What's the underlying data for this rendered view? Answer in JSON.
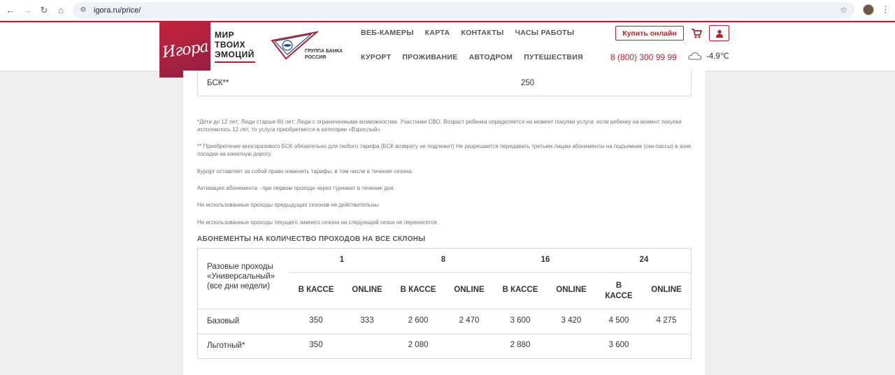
{
  "browser": {
    "url": "igora.ru/price/"
  },
  "header": {
    "logo_text": "Игора",
    "slogan": [
      "МИР",
      "ТВОИХ",
      "ЭМОЦИЙ"
    ],
    "bank_text": [
      "ГРУППА БАНКА",
      "РОССИЯ"
    ],
    "nav_top": [
      "ВЕБ-КАМЕРЫ",
      "КАРТА",
      "КОНТАКТЫ",
      "ЧАСЫ РАБОТЫ"
    ],
    "nav_bottom": [
      "КУРОРТ",
      "ПРОЖИВАНИЕ",
      "АВТОДРОМ",
      "ПУТЕШЕСТВИЯ"
    ],
    "buy_label": "Купить онлайн",
    "phone": "8 (800) 300 99 99",
    "temperature": "-4.9℃",
    "accent_color": "#b3232f"
  },
  "bsk": {
    "label": "БСК**",
    "value": "250"
  },
  "notes": [
    "*Дети до 12 лет; Люди старше 60 лет; Люди с ограниченными возможностми. Участники СВО. Возраст ребенка определяется на момент покупки услуги: если ребенку на момент покупки исполнилось 12 лет, то услуга приобретается в категории «Взрослый».",
    "** Приобретение многоразового БСК обязательно для любого тарифа (БСК возврату не подлежит) Не разрешается передавать третьим лицам абонементы на подъемник (ски-пассы) в зоне посадки на канатную дорогу.",
    "Курорт оставляет за собой право изменять тарифы, в том числе в течение сезона.",
    "Активация абонемента - при первом проходе через турникет в течение дня.",
    "Не использованные проходы предыдущих сезонов не действительны.",
    "Не использованные проходы текущего зимнего сезона на следующий сезон не переносятся."
  ],
  "passes": {
    "title": "АБОНЕМЕНТЫ НА КОЛИЧЕСТВО ПРОХОДОВ НА ВСЕ СКЛОНЫ",
    "corner_label": [
      "Разовые проходы",
      "«Универсальный»",
      "(все дни недели)"
    ],
    "groups": [
      "1",
      "8",
      "16",
      "24"
    ],
    "sub_headers": [
      "В КАССЕ",
      "ONLINE",
      "В КАССЕ",
      "ONLINE",
      "В КАССЕ",
      "ONLINE",
      "В КАССЕ",
      "ONLINE"
    ],
    "rows": [
      {
        "label": "Базовый",
        "cells": [
          "350",
          "333",
          "2 600",
          "2 470",
          "3 600",
          "3 420",
          "4 500",
          "4 275"
        ]
      },
      {
        "label": "Льготный*",
        "cells": [
          "350",
          "",
          "2 080",
          "",
          "2 880",
          "",
          "3 600",
          ""
        ]
      }
    ]
  }
}
